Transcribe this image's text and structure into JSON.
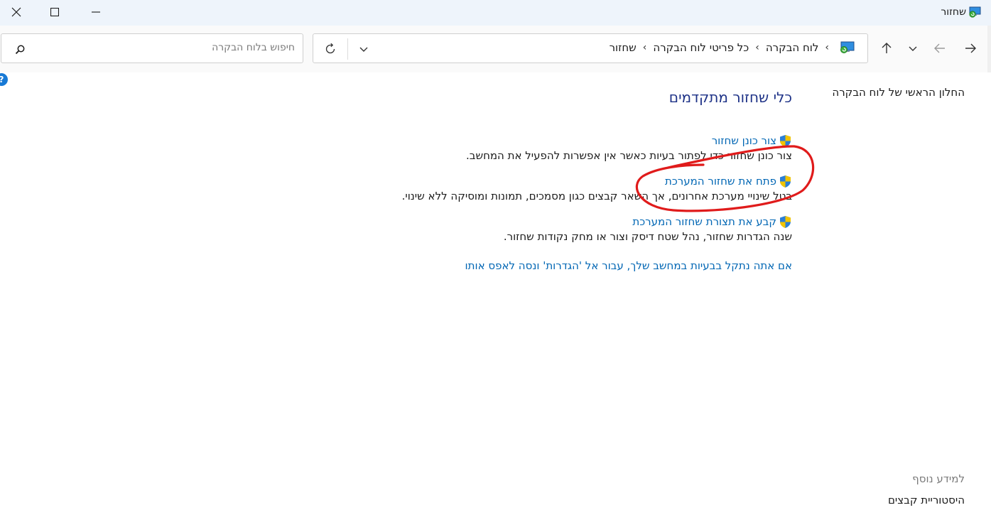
{
  "window": {
    "title": "שחזור",
    "app_icon": "recovery-icon",
    "controls": {
      "minimize_icon": "minimize-icon",
      "maximize_icon": "maximize-icon",
      "close_icon": "close-icon"
    }
  },
  "navbar": {
    "search_placeholder": "חיפוש בלוח הבקרה",
    "breadcrumbs": [
      "לוח הבקרה",
      "כל פריטי לוח הבקרה",
      "שחזור"
    ],
    "icons": [
      "back-icon",
      "forward-icon",
      "recent-locations-icon",
      "up-icon",
      "refresh-icon",
      "address-dropdown-icon",
      "search-icon"
    ]
  },
  "sidebar": {
    "home_link": "החלון הראשי של לוח הבקרה",
    "see_also": "למידע נוסף",
    "file_history": "היסטוריית קבצים"
  },
  "main": {
    "heading": "כלי שחזור מתקדמים",
    "items": [
      {
        "title": "צור כונן שחזור",
        "desc": "צור כונן שחזור כדי לפתור בעיות כאשר אין אפשרות להפעיל את המחשב."
      },
      {
        "title": "פתח את שחזור המערכת",
        "desc": "בטל שינויי מערכת אחרונים, אך השאר קבצים כגון מסמכים, תמונות ומוסיקה ללא שינוי."
      },
      {
        "title": "קבע את תצורת שחזור המערכת",
        "desc": "שנה הגדרות שחזור, נהל שטח דיסק וצור או מחק נקודות שחזור."
      }
    ],
    "reset_link": "אם אתה נתקל בבעיות במחשב שלך, עבור אל 'הגדרות' ונסה לאפס אותו"
  },
  "annotation": {
    "shape": "hand-drawn-ellipse",
    "color": "#e01b1b",
    "target": "main.items.1.title"
  },
  "colors": {
    "link": "#0066b4",
    "heading": "#1e3287",
    "titlebar": "#eef4fb"
  }
}
